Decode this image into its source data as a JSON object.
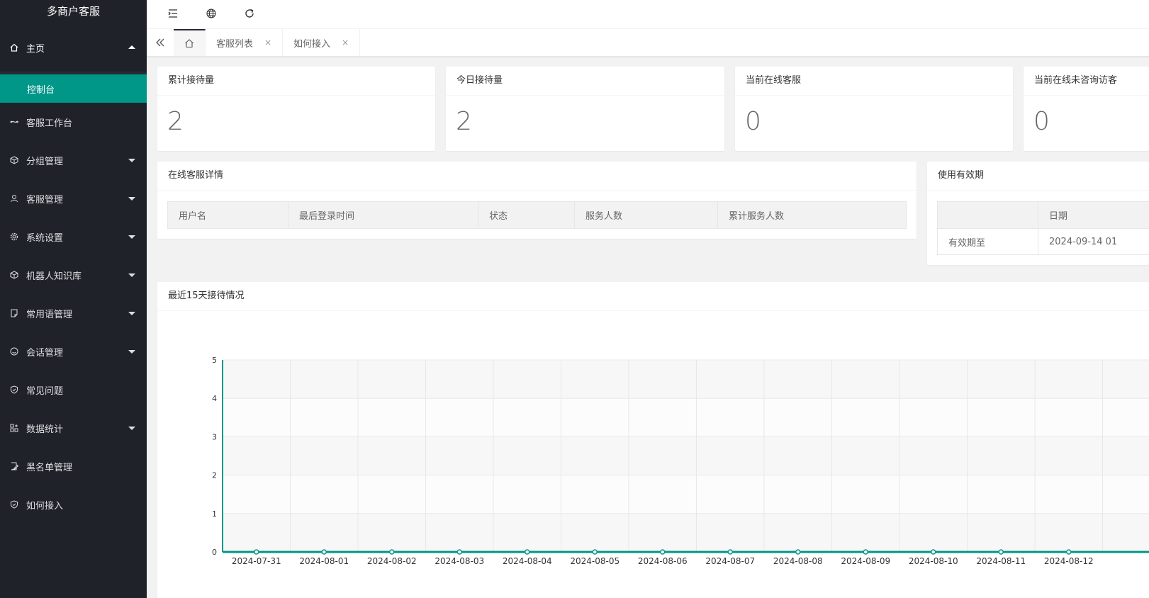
{
  "app": {
    "title": "多商户客服"
  },
  "sidebar": {
    "home": {
      "label": "主页",
      "icon": "home-icon"
    },
    "home_sub": {
      "label": "控制台"
    },
    "items": [
      {
        "label": "客服工作台",
        "icon": "infinity-icon",
        "has_arrow": false
      },
      {
        "label": "分组管理",
        "icon": "cube-icon",
        "has_arrow": true
      },
      {
        "label": "客服管理",
        "icon": "user-icon",
        "has_arrow": true
      },
      {
        "label": "系统设置",
        "icon": "gear-icon",
        "has_arrow": true
      },
      {
        "label": "机器人知识库",
        "icon": "cube-icon",
        "has_arrow": true
      },
      {
        "label": "常用语管理",
        "icon": "note-icon",
        "has_arrow": true
      },
      {
        "label": "会话管理",
        "icon": "smile-icon",
        "has_arrow": true
      },
      {
        "label": "常见问题",
        "icon": "shield-check-icon",
        "has_arrow": false
      },
      {
        "label": "数据统计",
        "icon": "apps-icon",
        "has_arrow": true
      },
      {
        "label": "黑名单管理",
        "icon": "edit-doc-icon",
        "has_arrow": false
      },
      {
        "label": "如何接入",
        "icon": "shield-check-icon",
        "has_arrow": false
      }
    ]
  },
  "header": {
    "buttons": [
      "menu-toggle-icon",
      "globe-icon",
      "refresh-icon"
    ]
  },
  "tabs": {
    "items": [
      {
        "label": "客服列表"
      },
      {
        "label": "如何接入"
      }
    ],
    "close_glyph": "×"
  },
  "stats": [
    {
      "title": "累计接待量",
      "value": "2"
    },
    {
      "title": "今日接待量",
      "value": "2"
    },
    {
      "title": "当前在线客服",
      "value": "0"
    },
    {
      "title": "当前在线未咨询访客",
      "value": "0"
    }
  ],
  "online_panel": {
    "title": "在线客服详情",
    "columns": [
      "用户名",
      "最后登录时间",
      "状态",
      "服务人数",
      "累计服务人数"
    ]
  },
  "validity_panel": {
    "title": "使用有效期",
    "columns": [
      "",
      "日期"
    ],
    "row": {
      "label": "有效期至",
      "value": "2024-09-14 01"
    }
  },
  "chart_panel": {
    "title": "最近15天接待情况"
  },
  "chart_data": {
    "type": "line",
    "x": [
      "2024-07-31",
      "2024-08-01",
      "2024-08-02",
      "2024-08-03",
      "2024-08-04",
      "2024-08-05",
      "2024-08-06",
      "2024-08-07",
      "2024-08-08",
      "2024-08-09",
      "2024-08-10",
      "2024-08-11",
      "2024-08-12"
    ],
    "series": [
      {
        "values": [
          0,
          0,
          0,
          0,
          0,
          0,
          0,
          0,
          0,
          0,
          0,
          0,
          0
        ]
      }
    ],
    "ylim": [
      0,
      5
    ],
    "yticks": [
      0,
      1,
      2,
      3,
      4,
      5
    ],
    "grid": true,
    "color": "#009688"
  }
}
